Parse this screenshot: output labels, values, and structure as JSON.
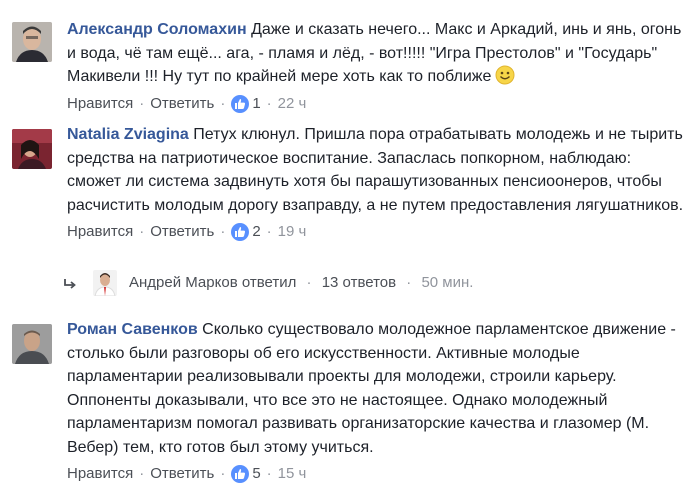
{
  "comments": [
    {
      "author": "Александр Соломахин",
      "text": "Даже и сказать нечего... Макс и Аркадий, инь и янь, огонь и вода, чё там ещё... ага, - пламя и лёд, - вот!!!!! \"Игра Престолов\" и \"Государь\" Макивели !!! Ну тут по крайней мере хоть как то поближе",
      "like_label": "Нравится",
      "reply_label": "Ответить",
      "reactions": "1",
      "time": "22 ч"
    },
    {
      "author": "Natalia Zviagina",
      "text": "Петух клюнул. Пришла пора отрабатывать молодежь и не тырить средства на патриотическое воспитание. Запаслась попкорном, наблюдаю: сможет ли система задвинуть хотя бы парашутизованных пенсиоонеров, чтобы расчистить молодым дорогу взаправду, а не путем предоставления лягушатников.",
      "like_label": "Нравится",
      "reply_label": "Ответить",
      "reactions": "2",
      "time": "19 ч"
    },
    {
      "author": "Роман Савенков",
      "text": "Сколько существовало молодежное парламентское движение - столько были разговоры об его искусственности. Активные молодые парламентарии реализовывали проекты для молодежи, строили карьеру. Оппоненты доказывали, что все это не настоящее. Однако молодежный парламентаризм помогал развивать организаторские качества и глазомер (М. Вебер) тем, кто готов был этому учиться.",
      "like_label": "Нравится",
      "reply_label": "Ответить",
      "reactions": "5",
      "time": "15 ч"
    }
  ],
  "reply_summary": {
    "text": "Андрей Марков ответил",
    "count_label": "13 ответов",
    "time": "50 мин."
  },
  "colors": {
    "author": "#365899",
    "action": "#4b4f56",
    "muted": "#90949c",
    "like_blue": "#5890ff"
  },
  "icons": [
    "like-thumb-icon",
    "smiley-icon",
    "reply-arrow-icon"
  ]
}
